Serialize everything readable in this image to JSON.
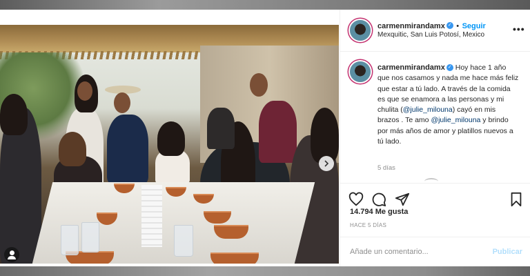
{
  "post": {
    "username": "carmenmirandamx",
    "follow_label": "Seguir",
    "location": "Mexquitic, San Luis Potosí, Mexico",
    "more_icon": "more-icon",
    "caption": {
      "username": "carmenmirandamx",
      "part1": "Hoy hace 1 año que nos casamos y nada me hace más feliz que estar a tú lado. A través de la comida es que se enamora a las personas y mi chulita (",
      "mention1": "@julie_milouna",
      "part2": ") cayó en mis brazos . Te amo ",
      "mention2": "@julie_milouna",
      "part3": " y brindo por más años de amor y platillos nuevos a tú lado."
    },
    "caption_time": "5 días",
    "likes": "14.794 Me gusta",
    "posted_ago": "HACE 5 DÍAS",
    "comment_placeholder": "Añade un comentario...",
    "publish_label": "Publicar"
  },
  "icons": {
    "like": "heart-icon",
    "comment": "comment-icon",
    "share": "share-icon",
    "save": "bookmark-icon",
    "next": "chevron-right-icon",
    "tag": "user-tag-icon",
    "verified": "verified-badge-icon"
  },
  "colors": {
    "accent": "#0095f6",
    "verified": "#3897f0",
    "mention": "#00376b",
    "publish_disabled": "#b2dffc",
    "secondary_text": "#8e8e8e"
  }
}
